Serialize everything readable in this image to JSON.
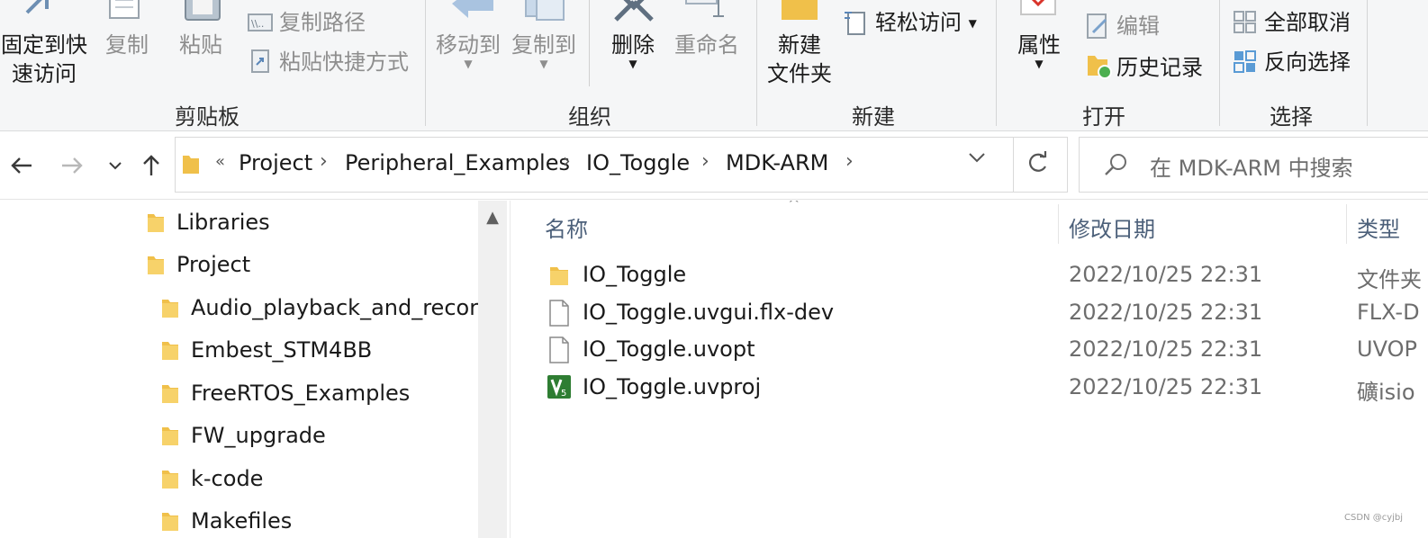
{
  "ribbon": {
    "clipboard": {
      "pin_line1": "固定到快",
      "pin_line2": "速访问",
      "copy": "复制",
      "paste": "粘贴",
      "copy_path": "复制路径",
      "paste_shortcut": "粘贴快捷方式",
      "group": "剪贴板"
    },
    "organize": {
      "move_to": "移动到",
      "copy_to": "复制到",
      "delete": "删除",
      "rename": "重命名",
      "group": "组织"
    },
    "new": {
      "new_folder_line1": "新建",
      "new_folder_line2": "文件夹",
      "easy_access": "轻松访问",
      "group": "新建"
    },
    "open": {
      "properties": "属性",
      "edit": "编辑",
      "history": "历史记录",
      "group": "打开"
    },
    "select": {
      "select_none": "全部取消",
      "invert_selection": "反向选择",
      "group": "选择"
    }
  },
  "address": {
    "overflow": "«",
    "crumbs": [
      "Project",
      "Peripheral_Examples",
      "IO_Toggle",
      "MDK-ARM"
    ],
    "search_placeholder": "在 MDK-ARM 中搜索"
  },
  "nav_tree": [
    {
      "label": "Libraries"
    },
    {
      "label": "Project"
    },
    {
      "label": "Audio_playback_and_record"
    },
    {
      "label": "Embest_STM4BB"
    },
    {
      "label": "FreeRTOS_Examples"
    },
    {
      "label": "FW_upgrade"
    },
    {
      "label": "k-code"
    },
    {
      "label": "Makefiles"
    }
  ],
  "file_list": {
    "columns": {
      "name": "名称",
      "date": "修改日期",
      "type": "类型"
    },
    "rows": [
      {
        "name": "IO_Toggle",
        "date": "2022/10/25 22:31",
        "type": "文件夹",
        "icon": "folder-icon"
      },
      {
        "name": "IO_Toggle.uvgui.flx-dev",
        "date": "2022/10/25 22:31",
        "type": "FLX-D",
        "icon": "file-icon"
      },
      {
        "name": "IO_Toggle.uvopt",
        "date": "2022/10/25 22:31",
        "type": "UVOP",
        "icon": "file-icon"
      },
      {
        "name": "IO_Toggle.uvproj",
        "date": "2022/10/25 22:31",
        "type": "礦isio",
        "icon": "keil-project-icon"
      }
    ]
  },
  "watermark": "CSDN @cyjbj",
  "colors": {
    "ribbon_bg": "#f5f6f7",
    "folder_yellow": "#f0c04a",
    "header_text": "#4c607a",
    "keil_green": "#2e7d32"
  }
}
